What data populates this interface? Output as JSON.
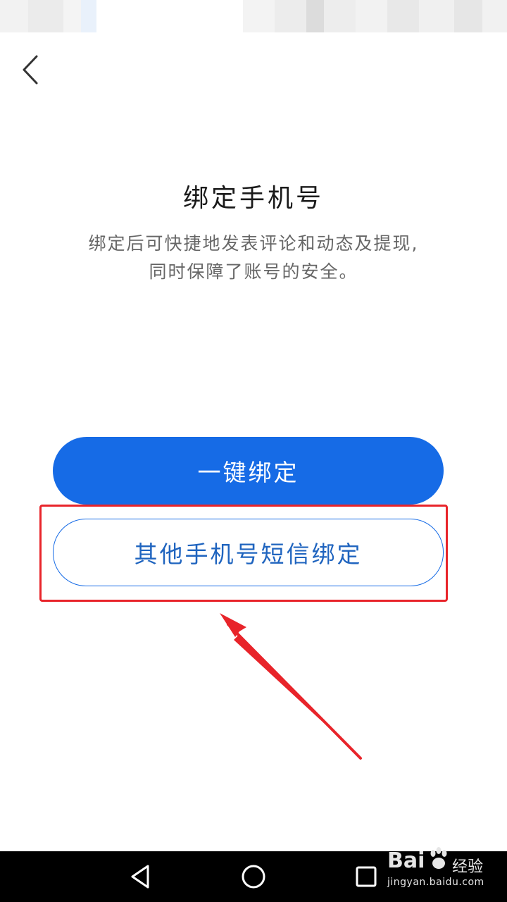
{
  "header": {
    "back_icon": "chevron-left-icon"
  },
  "main": {
    "title": "绑定手机号",
    "description_line1": "绑定后可快捷地发表评论和动态及提现,",
    "description_line2": "同时保障了账号的安全。",
    "one_click_bind_label": "一键绑定",
    "other_phone_sms_bind_label": "其他手机号短信绑定"
  },
  "annotations": {
    "highlight_color": "#e8242a"
  },
  "nav_bar": {
    "back_icon": "triangle-back-icon",
    "home_icon": "circle-home-icon",
    "recent_icon": "square-recent-icon"
  },
  "watermark": {
    "brand": "Bai",
    "brand_suffix": "经验",
    "url": "jingyan.baidu.com"
  },
  "colors": {
    "accent": "#166be6",
    "secondary_text": "#1f64bf",
    "title_text": "#1a1a1a",
    "body_text": "#666666",
    "nav_bar_bg": "#000000"
  }
}
